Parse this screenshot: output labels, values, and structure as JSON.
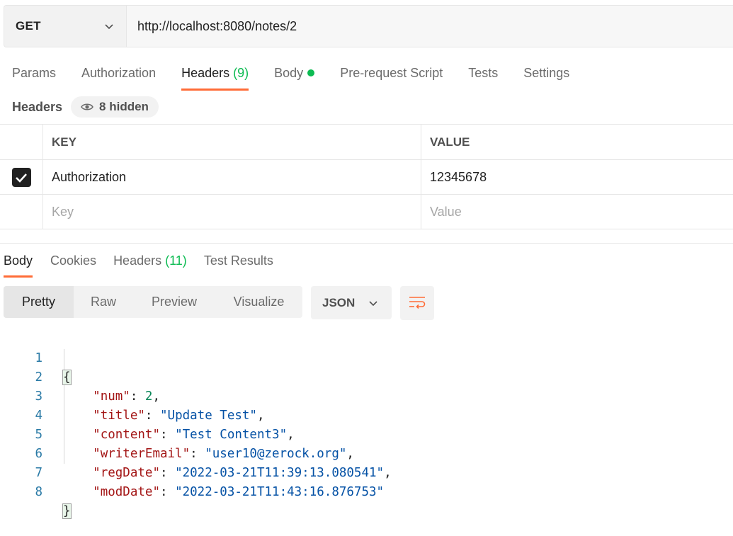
{
  "request": {
    "method": "GET",
    "url": "http://localhost:8080/notes/2"
  },
  "request_tabs": [
    {
      "label": "Params"
    },
    {
      "label": "Authorization"
    },
    {
      "label": "Headers",
      "count": "(9)"
    },
    {
      "label": "Body"
    },
    {
      "label": "Pre-request Script"
    },
    {
      "label": "Tests"
    },
    {
      "label": "Settings"
    }
  ],
  "headers_section": {
    "title": "Headers",
    "hidden_label": "8 hidden",
    "columns": {
      "key": "KEY",
      "value": "VALUE"
    },
    "rows": [
      {
        "key": "Authorization",
        "value": "12345678",
        "checked": true
      }
    ],
    "new_row": {
      "key_placeholder": "Key",
      "value_placeholder": "Value"
    }
  },
  "response_tabs": [
    {
      "label": "Body"
    },
    {
      "label": "Cookies"
    },
    {
      "label": "Headers",
      "count": "(11)"
    },
    {
      "label": "Test Results"
    }
  ],
  "view_modes": [
    "Pretty",
    "Raw",
    "Preview",
    "Visualize"
  ],
  "format": "JSON",
  "icons": {
    "method_dropdown": "chevron-down-icon",
    "hidden_headers": "eye-icon",
    "format_dropdown": "chevron-down-icon",
    "wrap": "wrap-lines-icon",
    "header_checkbox": "check-icon"
  },
  "colors": {
    "accent": "#ff6c37",
    "count": "#0cbb52",
    "json_key": "#a31515",
    "json_string": "#0451a5",
    "json_number": "#098658",
    "line_number": "#2a7aa6"
  },
  "response_body": {
    "line_numbers": [
      "1",
      "2",
      "3",
      "4",
      "5",
      "6",
      "7",
      "8"
    ],
    "open_brace": "{",
    "close_brace": "}",
    "fields": [
      {
        "key": "\"num\"",
        "value": "2",
        "type": "number"
      },
      {
        "key": "\"title\"",
        "value": "\"Update Test\"",
        "type": "string"
      },
      {
        "key": "\"content\"",
        "value": "\"Test Content3\"",
        "type": "string"
      },
      {
        "key": "\"writerEmail\"",
        "value": "\"user10@zerock.org\"",
        "type": "string"
      },
      {
        "key": "\"regDate\"",
        "value": "\"2022-03-21T11:39:13.080541\"",
        "type": "string"
      },
      {
        "key": "\"modDate\"",
        "value": "\"2022-03-21T11:43:16.876753\"",
        "type": "string"
      }
    ]
  }
}
